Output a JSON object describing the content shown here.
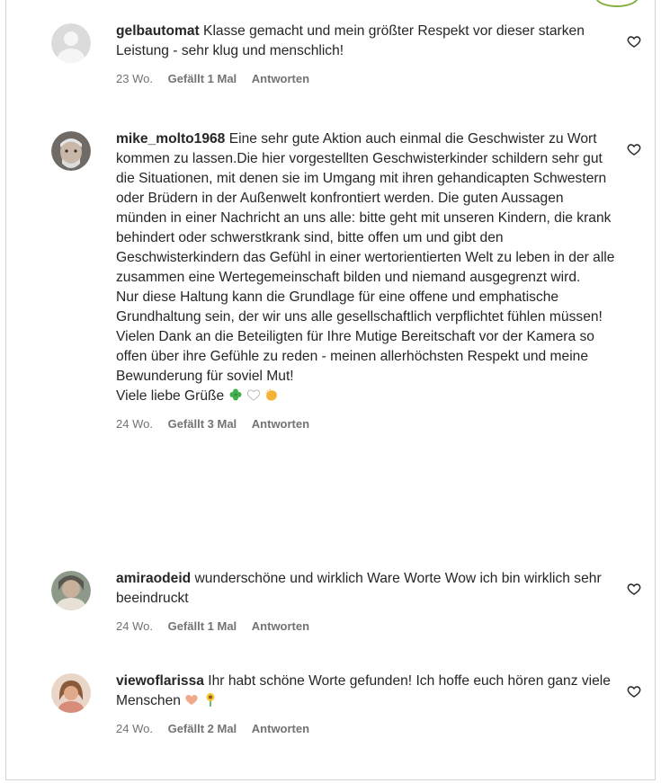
{
  "comments": [
    {
      "username": "gelbautomat",
      "text": "Klasse gemacht und mein größter Respekt vor dieser starken Leistung - sehr klug und menschlich!",
      "age": "23 Wo.",
      "likes": "Gefällt 1 Mal",
      "reply": "Antworten",
      "avatar_icon": "default-avatar-icon"
    },
    {
      "username": "mike_molto1968",
      "text": "Eine sehr gute Aktion auch einmal die Geschwister zu Wort kommen zu lassen.Die hier vorgestellten Geschwisterkinder schildern sehr gut die Situationen, mit denen sie im Umgang mit ihren gehandicapten Schwestern oder Brüdern in der Außenwelt konfrontiert werden. Die guten Aussagen münden in einer Nachricht an uns alle: bitte geht mit unseren Kindern, die krank behindert oder schwerstkrank sind, bitte offen um und gibt den Geschwisterkindern das Gefühl in einer wertorientierten Welt zu leben in der alle zusammen eine Wertegemeinschaft bilden und niemand ausgegrenzt wird.",
      "text2": "Nur diese Haltung kann die Grundlage für eine offene und emphatische Grundhaltung sein, der wir uns alle gesellschaftlich verpflichtet fühlen müssen!",
      "text3": "Vielen Dank an die Beteiligten für Ihre Mutige Bereitschaft vor der Kamera so offen über ihre Gefühle zu reden - meinen allerhöchsten Respekt und meine Bewunderung für soviel Mut!",
      "text4": "Viele liebe Grüße",
      "age": "24 Wo.",
      "likes": "Gefällt 3 Mal",
      "reply": "Antworten",
      "emojis": [
        "four-leaf-clover-icon",
        "white-heart-icon",
        "clapping-hands-icon"
      ]
    },
    {
      "username": "amiraodeid",
      "text": "wunderschöne und wirklich Ware Worte Wow ich bin wirklich sehr beeindruckt",
      "age": "24 Wo.",
      "likes": "Gefällt 1 Mal",
      "reply": "Antworten"
    },
    {
      "username": "viewoflarissa",
      "text": "Ihr habt schöne Worte gefunden! Ich hoffe euch hören ganz viele Menschen",
      "age": "24 Wo.",
      "likes": "Gefällt 2 Mal",
      "reply": "Antworten",
      "emojis": [
        "heart-hands-icon",
        "sunflower-icon"
      ]
    }
  ],
  "colors": {
    "text": "#262626",
    "meta": "#737373",
    "border": "#d4d4d4"
  }
}
